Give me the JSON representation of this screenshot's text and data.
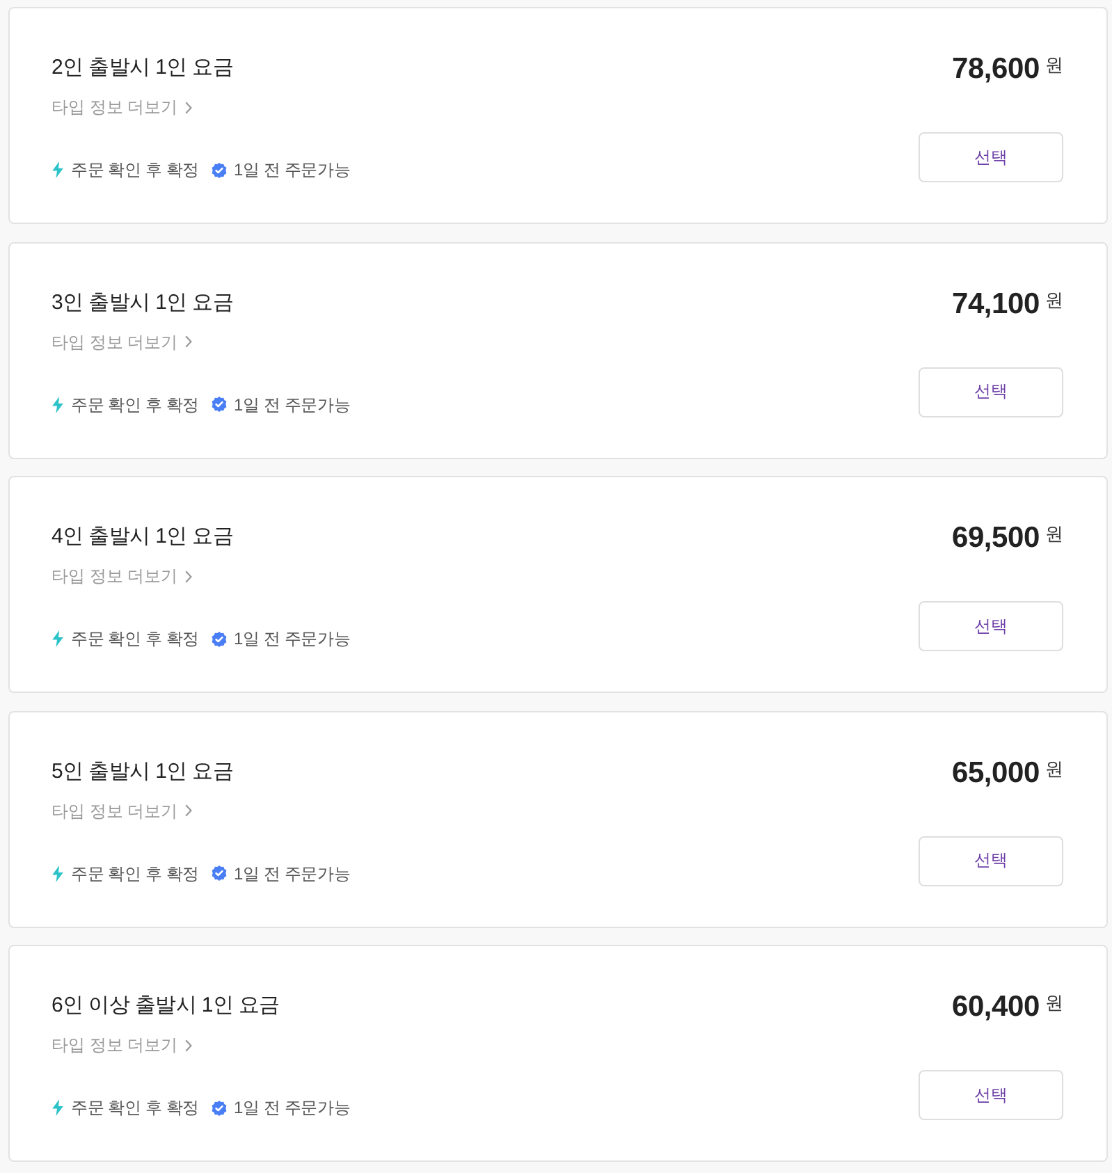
{
  "options": [
    {
      "title": "2인 출발시 1인 요금",
      "detail_link": "타입 정보 더보기",
      "tags": [
        {
          "kind": "instant",
          "label": "주문 확인 후 확정"
        },
        {
          "kind": "verified",
          "label": "1일 전 주문가능"
        }
      ],
      "price": "78,600",
      "currency": "원",
      "button": "선택"
    },
    {
      "title": "3인 출발시 1인 요금",
      "detail_link": "타입 정보 더보기",
      "tags": [
        {
          "kind": "instant",
          "label": "주문 확인 후 확정"
        },
        {
          "kind": "verified",
          "label": "1일 전 주문가능"
        }
      ],
      "price": "74,100",
      "currency": "원",
      "button": "선택"
    },
    {
      "title": "4인 출발시 1인 요금",
      "detail_link": "타입 정보 더보기",
      "tags": [
        {
          "kind": "instant",
          "label": "주문 확인 후 확정"
        },
        {
          "kind": "verified",
          "label": "1일 전 주문가능"
        }
      ],
      "price": "69,500",
      "currency": "원",
      "button": "선택"
    },
    {
      "title": "5인 출발시 1인 요금",
      "detail_link": "타입 정보 더보기",
      "tags": [
        {
          "kind": "instant",
          "label": "주문 확인 후 확정"
        },
        {
          "kind": "verified",
          "label": "1일 전 주문가능"
        }
      ],
      "price": "65,000",
      "currency": "원",
      "button": "선택"
    },
    {
      "title": "6인 이상 출발시 1인 요금",
      "detail_link": "타입 정보 더보기",
      "tags": [
        {
          "kind": "instant",
          "label": "주문 확인 후 확정"
        },
        {
          "kind": "verified",
          "label": "1일 전 주문가능"
        }
      ],
      "price": "60,400",
      "currency": "원",
      "button": "선택"
    }
  ]
}
